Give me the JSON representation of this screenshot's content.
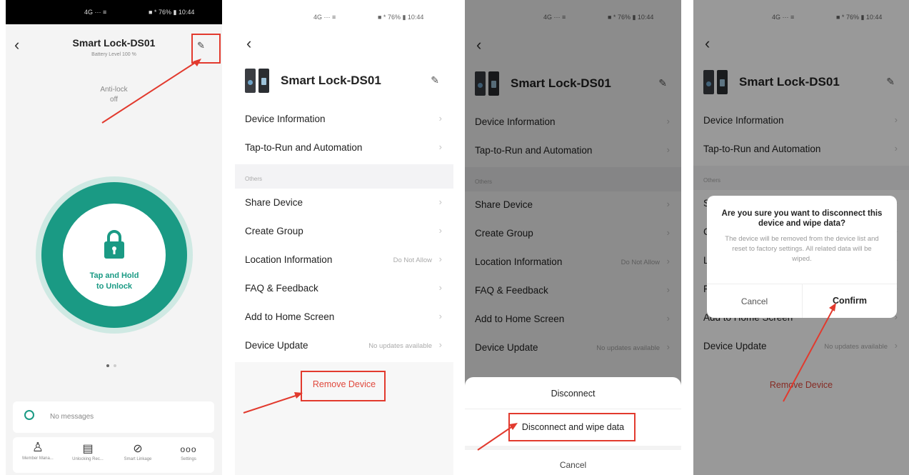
{
  "status_bar": {
    "left": "4G ··· ≡",
    "right": "■ * 76% ▮ 10:44"
  },
  "panel1": {
    "title": "Smart Lock-DS01",
    "battery": "Battery Level 100 %",
    "antilock_label": "Anti-lock",
    "antilock_value": "off",
    "unlock_line1": "Tap and Hold",
    "unlock_line2": "to Unlock",
    "messages": "No messages",
    "nav": [
      {
        "icon": "member-icon",
        "label": "Member Mana..."
      },
      {
        "icon": "record-icon",
        "label": "Unlocking Rec..."
      },
      {
        "icon": "link-icon",
        "label": "Smart Linkage"
      },
      {
        "icon": "more-icon",
        "label": "Settings"
      }
    ],
    "colors": {
      "accent": "#1a9a84",
      "ring": "#cfe9e3"
    }
  },
  "settings": {
    "title": "Smart Lock-DS01",
    "device_information": "Device Information",
    "tap_to_run": "Tap-to-Run and Automation",
    "others": "Others",
    "share_device": "Share Device",
    "create_group": "Create Group",
    "location_information": "Location Information",
    "location_value": "Do Not Allow",
    "faq": "FAQ & Feedback",
    "add_home": "Add to Home Screen",
    "device_update": "Device Update",
    "update_value": "No updates available",
    "remove_device": "Remove Device"
  },
  "sheet": {
    "disconnect": "Disconnect",
    "disconnect_wipe": "Disconnect and wipe data",
    "cancel": "Cancel"
  },
  "dialog": {
    "title": "Are you sure you want to disconnect this device and wipe data?",
    "body": "The device will be removed from the device list and reset to factory settings. All related data will be wiped.",
    "cancel": "Cancel",
    "confirm": "Confirm"
  },
  "colors": {
    "annotation": "#e23a2e",
    "remove": "#e0483c"
  }
}
